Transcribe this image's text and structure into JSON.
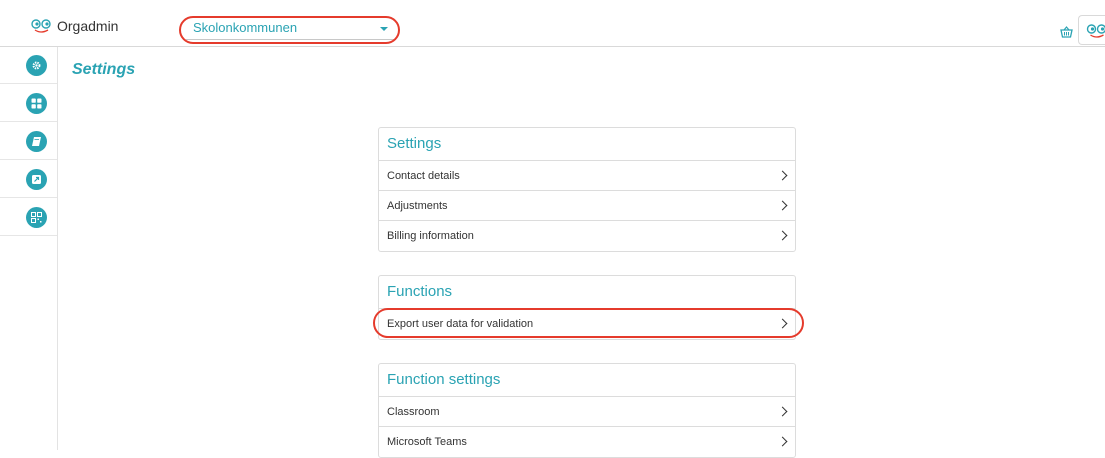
{
  "header": {
    "app_name": "Orgadmin",
    "org_select": {
      "value": "Skolonkommunen"
    }
  },
  "sidebar": {
    "items": [
      {
        "icon": "gear-icon"
      },
      {
        "icon": "grid-icon"
      },
      {
        "icon": "book-icon"
      },
      {
        "icon": "external-link-icon"
      },
      {
        "icon": "qr-code-icon"
      }
    ]
  },
  "page": {
    "title": "Settings"
  },
  "cards": {
    "settings": {
      "title": "Settings",
      "rows": [
        "Contact details",
        "Adjustments",
        "Billing information"
      ]
    },
    "functions": {
      "title": "Functions",
      "rows": [
        "Export user data for validation"
      ]
    },
    "function_settings": {
      "title": "Function settings",
      "rows": [
        "Classroom",
        "Microsoft Teams"
      ]
    }
  },
  "colors": {
    "accent": "#2aa3b3",
    "highlight": "#e53b2c"
  }
}
